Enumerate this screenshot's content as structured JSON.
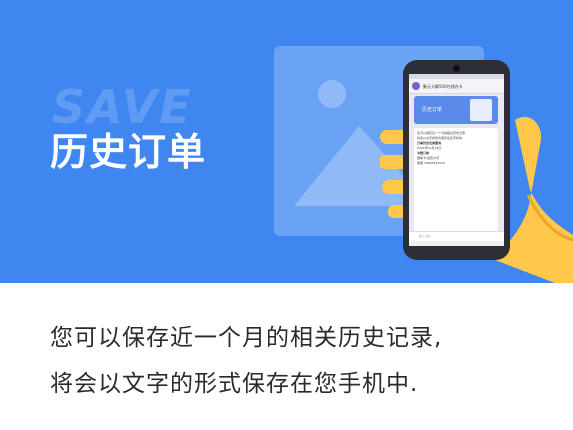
{
  "banner": {
    "watermark_word": "SAVE",
    "title": "历史订单",
    "background_color": "#3f86f0",
    "illustration_icon": "picture-icon"
  },
  "phone": {
    "chat_name": "聚元卡解500在线办卡",
    "card_title": "历史订单",
    "message_lines": [
      "您可以保存近一个月的相关历史记录,",
      "将会以文字的形式保存在您手机中.",
      "",
      "订单历史记录查询",
      "2021年10月15日",
      "卡密订单",
      "银联卡/话费/Q币",
      "客服:18898763543"
    ],
    "input_placeholder": "输入消息"
  },
  "caption": {
    "line1": "您可以保存近一个月的相关历史记录,",
    "line2": "将会以文字的形式保存在您手机中."
  }
}
